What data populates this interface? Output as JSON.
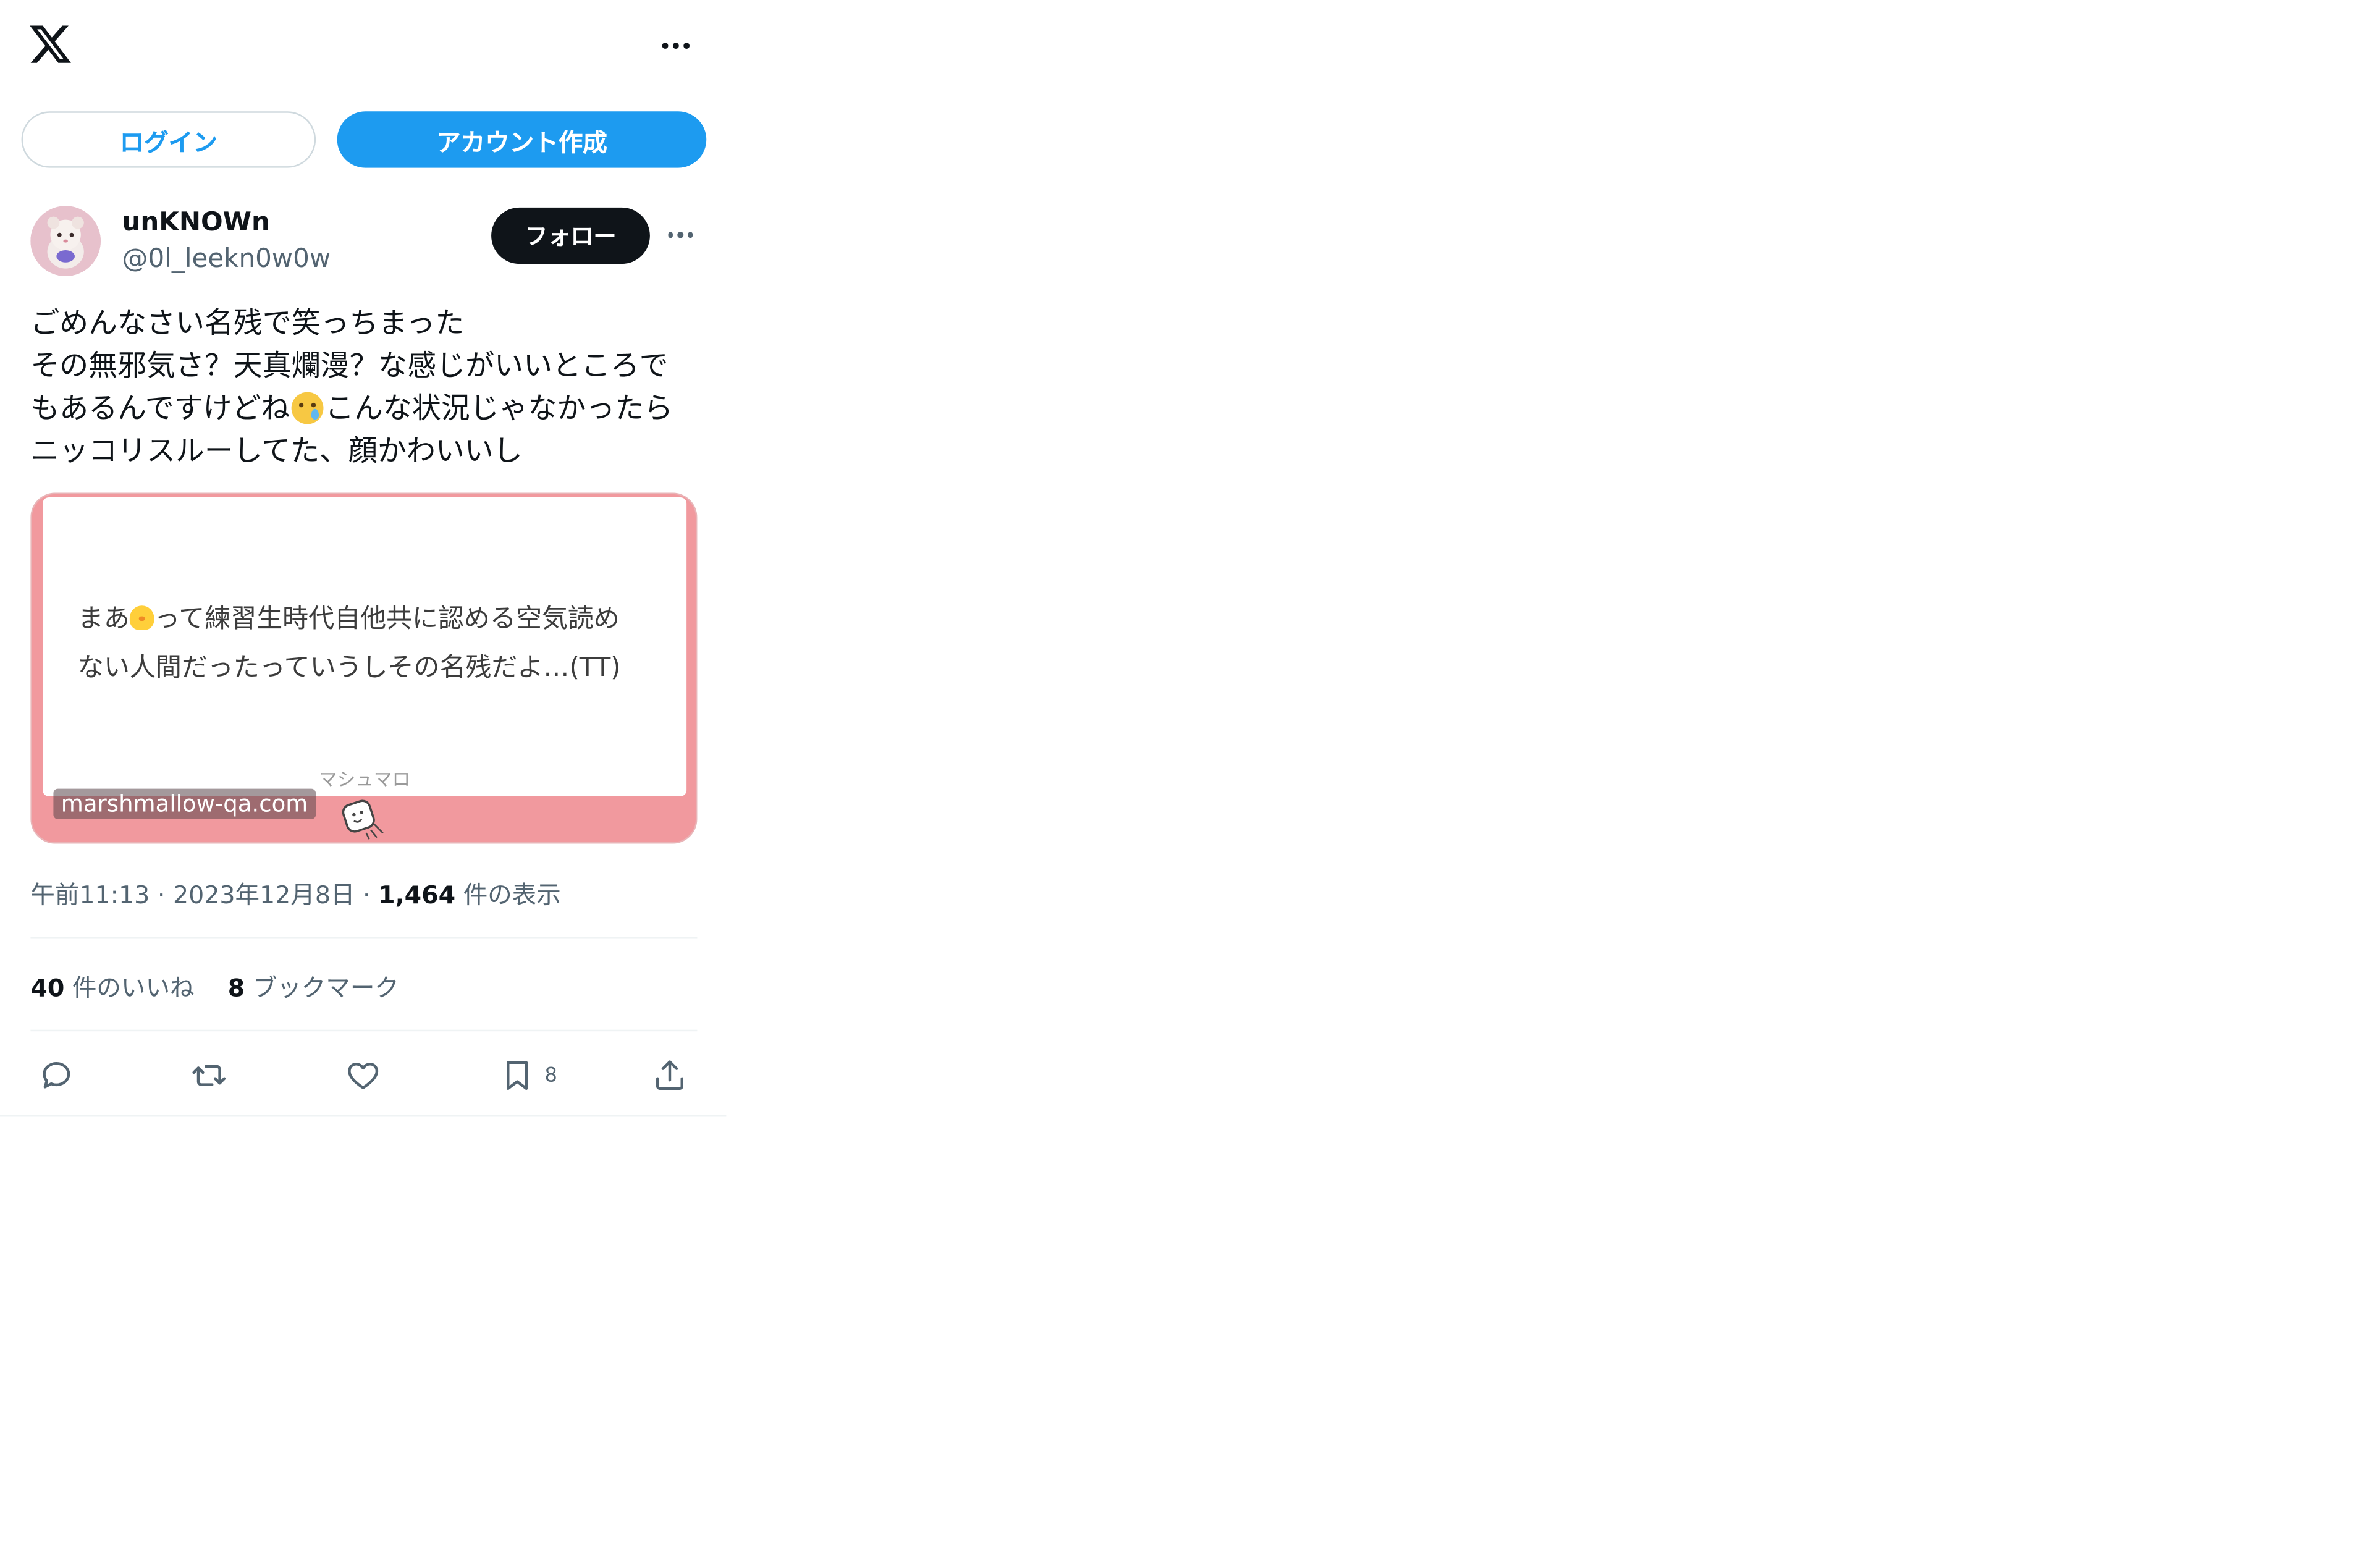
{
  "header": {
    "logo_icon": "x-logo-icon",
    "more_icon": "more-horizontal-icon"
  },
  "auth": {
    "login_label": "ログイン",
    "signup_label": "アカウント作成"
  },
  "author": {
    "name": "unKNOWn",
    "handle": "@0l_leekn0w0w",
    "follow_label": "フォロー",
    "avatar_icon": "avatar-hamster-icon"
  },
  "tweet": {
    "lines": [
      "ごめんなさい名残で笑っちまった",
      "その無邪気さ？天真爛漫？な感じがいいところで",
      "もあるんですけどね",
      "こんな状況じゃなかったら",
      "ニッコリスルーしてた、顔かわいいし"
    ],
    "emoji": "smiling-face-with-tear-emoji"
  },
  "card": {
    "text_line1_a": "まあ",
    "text_line1_b": "って練習生時代自他共に認める空気読め",
    "text_line2": "ない人間だったっていうしその名残だよ…(TT)",
    "brand": "マシュマロ",
    "domain": "marshmallow-qa.com",
    "emoji": "chick-emoji",
    "mascot_icon": "marshmallow-mascot-icon"
  },
  "meta": {
    "time": "午前11:13",
    "sep1": " · ",
    "date": "2023年12月8日",
    "sep2": " · ",
    "views_count": "1,464",
    "views_label": " 件の表示"
  },
  "stats": {
    "likes_count": "40",
    "likes_label": " 件のいいね",
    "bookmarks_count": "8",
    "bookmarks_label": " ブックマーク"
  },
  "actions": {
    "bookmark_count": "8"
  },
  "colors": {
    "accent": "#1d9bf0",
    "text_primary": "#0f1419",
    "text_secondary": "#536471",
    "card_border": "#f1999e"
  }
}
